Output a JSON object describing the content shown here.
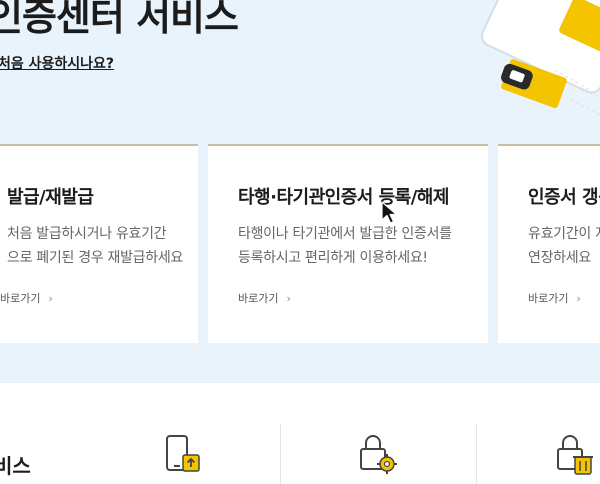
{
  "hero": {
    "title": "인증센터 서비스",
    "first_time_link": "처음 사용하시나요?"
  },
  "cards": [
    {
      "title": "발급/재발급",
      "desc_line1": "처음 발급하시거나 유효기간",
      "desc_line2": "으로 폐기된 경우 재발급하세요",
      "link": "바로가기"
    },
    {
      "title": "타행·타기관인증서 등록/해제",
      "desc_line1": "타행이나 타기관에서 발급한 인증서를",
      "desc_line2": "등록하시고 편리하게 이용하세요!",
      "link": "바로가기"
    },
    {
      "title": "인증서 갱신",
      "desc_line1": "유효기간이 지난",
      "desc_line2": "연장하세요",
      "link": "바로가기"
    }
  ],
  "bottom": {
    "title": "비스"
  },
  "icons": [
    "phone-upload-icon",
    "lock-gear-icon",
    "lock-trash-icon"
  ],
  "colors": {
    "hero_bg": "#e8f3fc",
    "accent_yellow": "#f5c400",
    "card_top_border": "#c8bfa3"
  }
}
